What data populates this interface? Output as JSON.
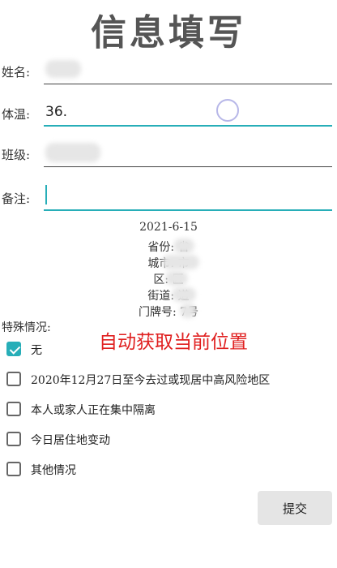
{
  "page": {
    "title": "信息填写"
  },
  "fields": {
    "name": {
      "label": "姓名:",
      "value": ""
    },
    "temp": {
      "label": "体温:",
      "value": "36."
    },
    "class": {
      "label": "班级:",
      "value": ""
    },
    "note": {
      "label": "备注:",
      "value": ""
    }
  },
  "location": {
    "date": "2021-6-15",
    "province": "省份:      省",
    "city": "城市:      市",
    "district": "区:      区",
    "street": "街道:      道",
    "house": "门牌号:    7号"
  },
  "special": {
    "section_label": "特殊情况:",
    "auto_location": "自动获取当前位置",
    "options": [
      {
        "label": "无",
        "checked": true
      },
      {
        "label": "2020年12月27日至今去过或现居中高风险地区",
        "checked": false
      },
      {
        "label": "本人或家人正在集中隔离",
        "checked": false
      },
      {
        "label": "今日居住地变动",
        "checked": false
      },
      {
        "label": "其他情况",
        "checked": false
      }
    ]
  },
  "submit": {
    "label": "提交"
  },
  "colors": {
    "accent": "#27aeb8",
    "auto_text": "#e02020"
  }
}
